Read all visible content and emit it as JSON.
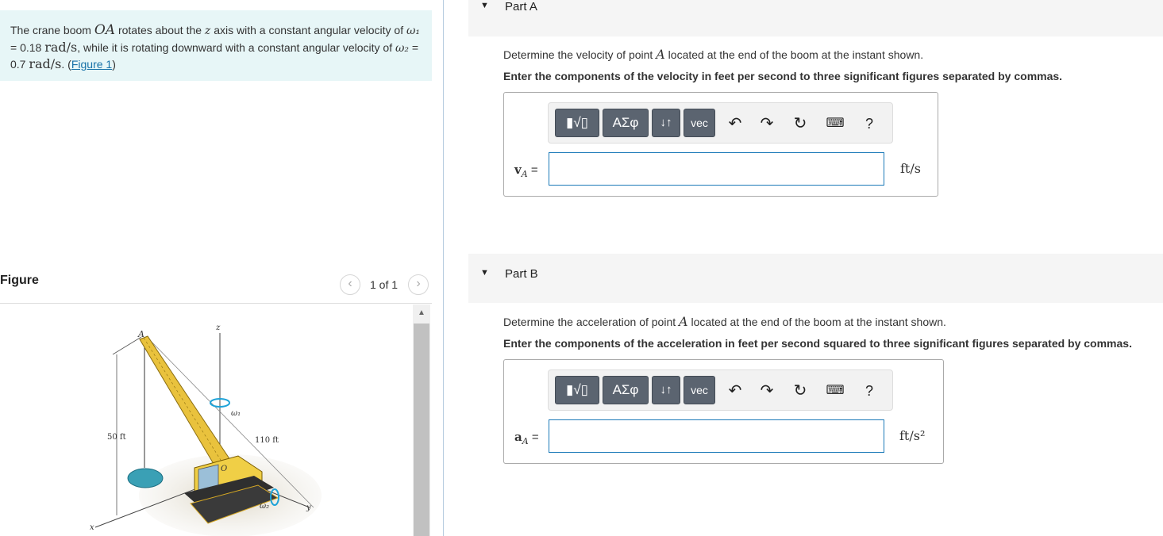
{
  "problem": {
    "text_1": "The crane boom ",
    "var_OA": "OA",
    "text_2": " rotates about the ",
    "var_z": "z",
    "text_3": " axis with a constant angular velocity of ",
    "omega1": "ω₁",
    "text_4": " = 0.18 ",
    "unit_rads_1": "rad/s",
    "text_5": ", while it is rotating downward with a constant angular velocity of ",
    "omega2": "ω₂",
    "text_6": " = 0.7 ",
    "unit_rads_2": "rad/s",
    "text_7": ". (",
    "figure_link": "Figure 1",
    "text_8": ")"
  },
  "figure": {
    "title": "Figure",
    "counter": "1 of 1",
    "prev_icon": "chevron-left-icon",
    "next_icon": "chevron-right-icon",
    "labels": {
      "A": "A",
      "z": "z",
      "omega1": "ω₁",
      "omega2": "ω₂",
      "height": "50 ft",
      "length": "110 ft",
      "O": "O",
      "x": "x",
      "y": "y"
    }
  },
  "partA": {
    "label": "Part A",
    "question_pre": "Determine the velocity of point ",
    "question_var": "A",
    "question_post": " located at the end of the boom at the instant shown.",
    "instruction": "Enter the components of the velocity in feet per second to three significant figures separated by commas.",
    "var_main": "v",
    "var_sub": "A",
    "equals": "=",
    "unit": "ft/s",
    "input_value": ""
  },
  "partB": {
    "label": "Part B",
    "question_pre": "Determine the acceleration of point ",
    "question_var": "A",
    "question_post": " located at the end of the boom at the instant shown.",
    "instruction": "Enter the components of the acceleration in feet per second squared to three significant figures separated by commas.",
    "var_main": "a",
    "var_sub": "A",
    "equals": "=",
    "unit": "ft/s²",
    "input_value": ""
  },
  "toolbar": {
    "greek": "ΑΣφ",
    "arrows": "↓↑",
    "vec": "vec",
    "help": "?",
    "icons": [
      "templates-icon",
      "undo-icon",
      "redo-icon",
      "reset-icon",
      "keyboard-icon"
    ]
  }
}
